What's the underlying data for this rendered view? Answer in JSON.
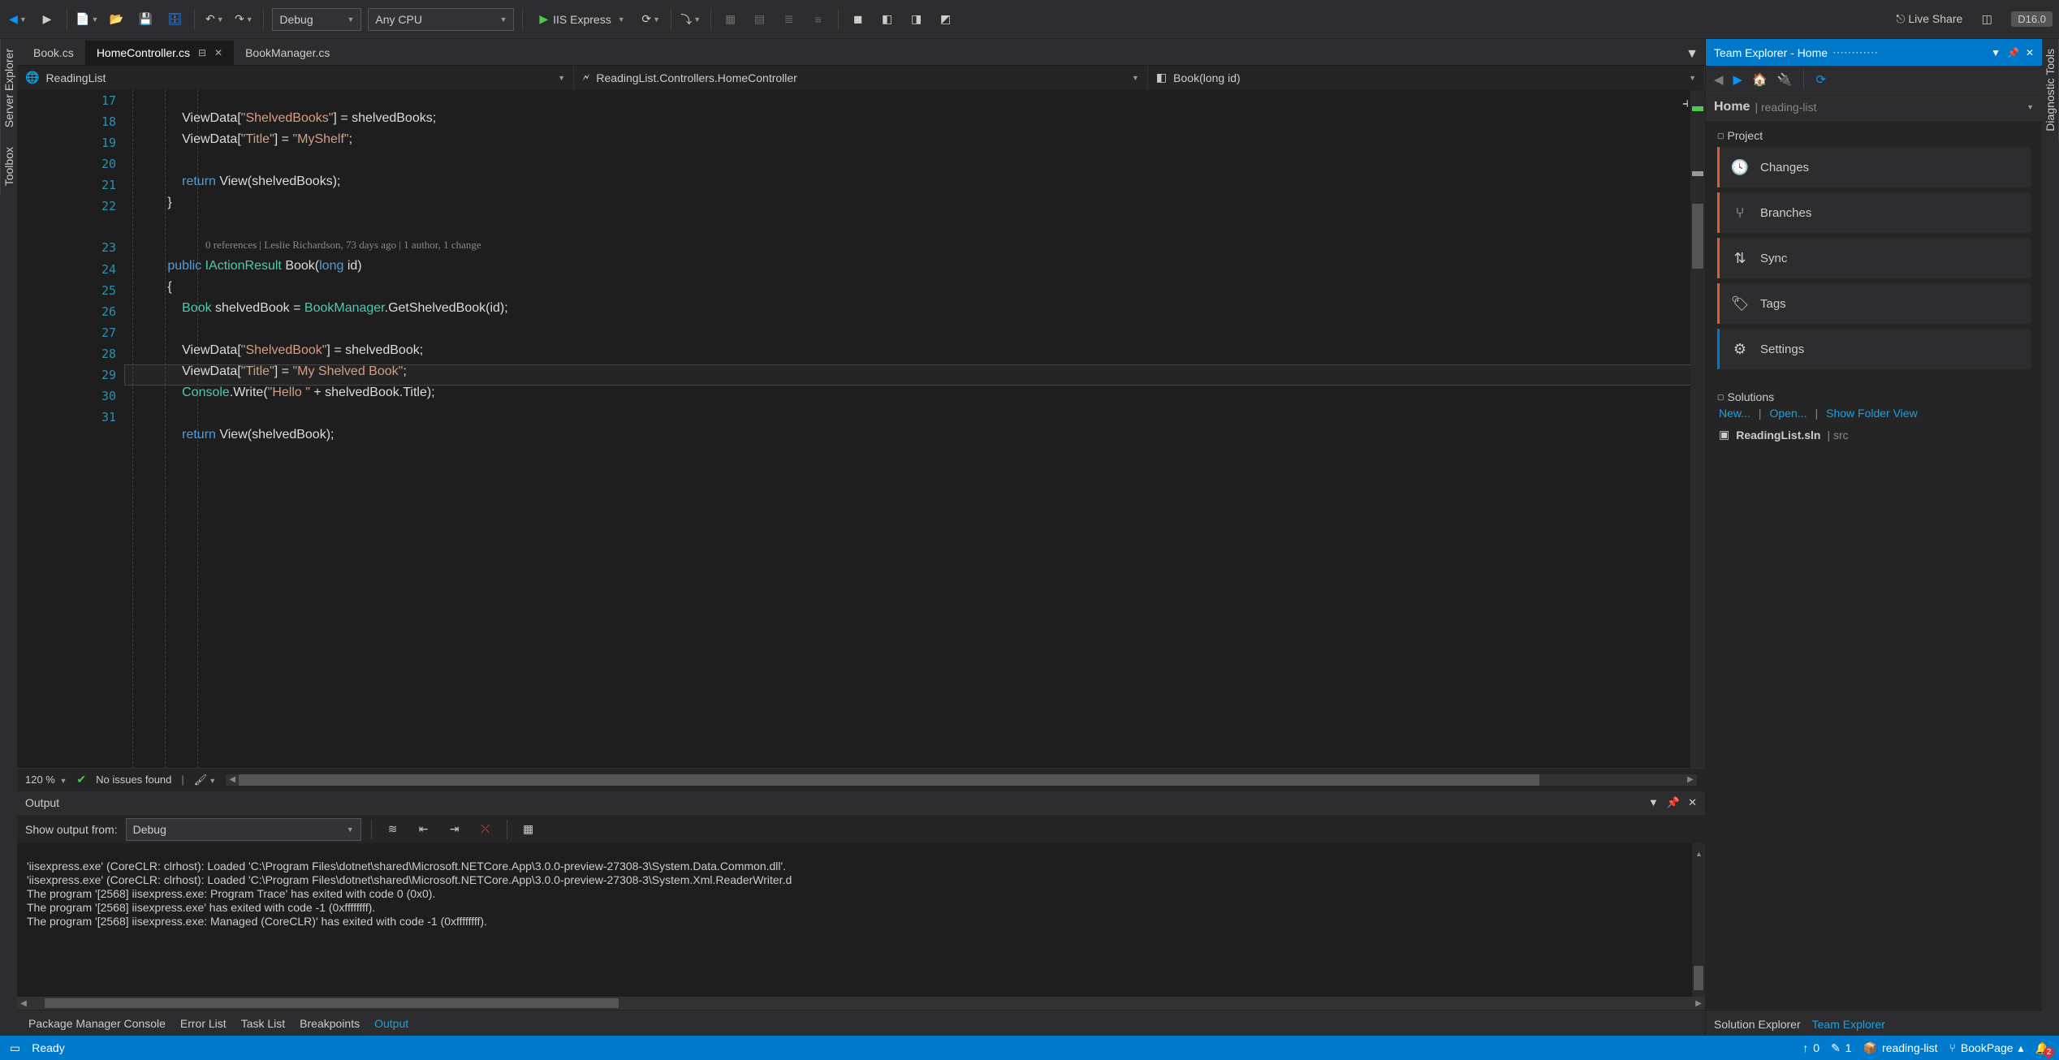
{
  "toolbar": {
    "config": "Debug",
    "platform": "Any CPU",
    "run_target": "IIS Express",
    "live_share": "Live Share",
    "version_badge": "D16.0"
  },
  "left_tabs": [
    "Server Explorer",
    "Toolbox"
  ],
  "right_tabs": [
    "Diagnostic Tools"
  ],
  "file_tabs": {
    "items": [
      "Book.cs",
      "HomeController.cs",
      "BookManager.cs"
    ],
    "active": "HomeController.cs"
  },
  "nav": {
    "project": "ReadingList",
    "class": "ReadingList.Controllers.HomeController",
    "member": "Book(long id)"
  },
  "editor": {
    "zoom": "120 %",
    "issues": "No issues found",
    "lines": [
      17,
      18,
      19,
      20,
      21,
      22,
      23,
      24,
      25,
      26,
      27,
      28,
      29,
      30,
      31
    ],
    "codelens": "0 references | Leslie Richardson, 73 days ago | 1 author, 1 change"
  },
  "output": {
    "title": "Output",
    "from_label": "Show output from:",
    "from_value": "Debug",
    "lines": [
      "'iisexpress.exe' (CoreCLR: clrhost): Loaded 'C:\\Program Files\\dotnet\\shared\\Microsoft.NETCore.App\\3.0.0-preview-27308-3\\System.Data.Common.dll'.",
      "'iisexpress.exe' (CoreCLR: clrhost): Loaded 'C:\\Program Files\\dotnet\\shared\\Microsoft.NETCore.App\\3.0.0-preview-27308-3\\System.Xml.ReaderWriter.d",
      "The program '[2568] iisexpress.exe: Program Trace' has exited with code 0 (0x0).",
      "The program '[2568] iisexpress.exe' has exited with code -1 (0xffffffff).",
      "The program '[2568] iisexpress.exe: Managed (CoreCLR)' has exited with code -1 (0xffffffff)."
    ]
  },
  "bottom_tabs": [
    "Package Manager Console",
    "Error List",
    "Task List",
    "Breakpoints",
    "Output"
  ],
  "team_explorer": {
    "title": "Team Explorer - Home",
    "crumb_main": "Home",
    "crumb_sub": "reading-list",
    "project_label": "Project",
    "items": [
      {
        "label": "Changes",
        "icon": "clock",
        "color": "orange"
      },
      {
        "label": "Branches",
        "icon": "branches",
        "color": "orange"
      },
      {
        "label": "Sync",
        "icon": "sync",
        "color": "orange"
      },
      {
        "label": "Tags",
        "icon": "tag",
        "color": "orange"
      },
      {
        "label": "Settings",
        "icon": "gear",
        "color": "blue"
      }
    ],
    "solutions_label": "Solutions",
    "links": [
      "New...",
      "Open...",
      "Show Folder View"
    ],
    "sln_name": "ReadingList.sln",
    "sln_dir": "src"
  },
  "te_btabs": [
    "Solution Explorer",
    "Team Explorer"
  ],
  "status": {
    "ready": "Ready",
    "up": "0",
    "down": "1",
    "repo": "reading-list",
    "branch": "BookPage",
    "notif": "2"
  }
}
